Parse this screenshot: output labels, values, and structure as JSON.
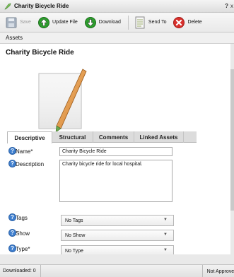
{
  "window": {
    "title": "Charity Bicycle Ride",
    "help": "?",
    "close": "x"
  },
  "toolbar": {
    "save_label": "Save",
    "update_file_label": "Update File",
    "download_label": "Download",
    "send_to_label": "Send To",
    "delete_label": "Delete"
  },
  "breadcrumb": {
    "label": "Assets"
  },
  "asset": {
    "title": "Charity Bicycle Ride"
  },
  "tabs": [
    {
      "label": "Descriptive",
      "active": true
    },
    {
      "label": "Structural",
      "active": false
    },
    {
      "label": "Comments",
      "active": false
    },
    {
      "label": "Linked Assets",
      "active": false
    }
  ],
  "form": {
    "name": {
      "label": "Name*",
      "value": "Charity Bicycle Ride"
    },
    "description": {
      "label": "Description",
      "value": "Charity bicycle ride for local hospital."
    },
    "tags": {
      "label": "Tags",
      "value": "No Tags"
    },
    "show": {
      "label": "Show",
      "value": "No Show"
    },
    "type": {
      "label": "Type*",
      "value": "No Type"
    }
  },
  "status": {
    "downloaded": "Downloaded: 0",
    "approval": "Not Approved"
  },
  "colors": {
    "help_icon": "#3f7fcf",
    "update_icon": "#2e9e2e",
    "delete_icon": "#d9302c"
  }
}
